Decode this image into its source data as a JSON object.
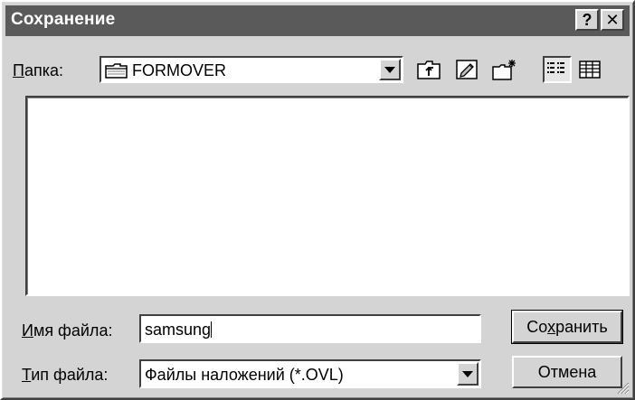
{
  "window": {
    "title": "Сохранение",
    "help_label": "?",
    "close_label": "✕"
  },
  "folder": {
    "label_prefix": "П",
    "label_rest": "апка:",
    "value": "FORMOVER",
    "icon": "folder-icon"
  },
  "toolbar": {
    "up_icon": "folder-up-icon",
    "desktop_icon": "desktop-icon",
    "new_folder_icon": "new-folder-icon",
    "list_view_icon": "list-view-icon",
    "details_view_icon": "details-view-icon"
  },
  "file_list": {
    "items": []
  },
  "filename": {
    "label_prefix": "И",
    "label_rest": "мя файла:",
    "value": "samsung"
  },
  "filetype": {
    "label_prefix": "Т",
    "label_rest": "ип файла:",
    "value": "Файлы наложений (*.OVL)"
  },
  "buttons": {
    "save_before": "Со",
    "save_underlined": "х",
    "save_after": "ранить",
    "cancel": "Отмена"
  },
  "colors": {
    "titlebar": "#5a5a5a",
    "face": "#d4d4d4"
  }
}
